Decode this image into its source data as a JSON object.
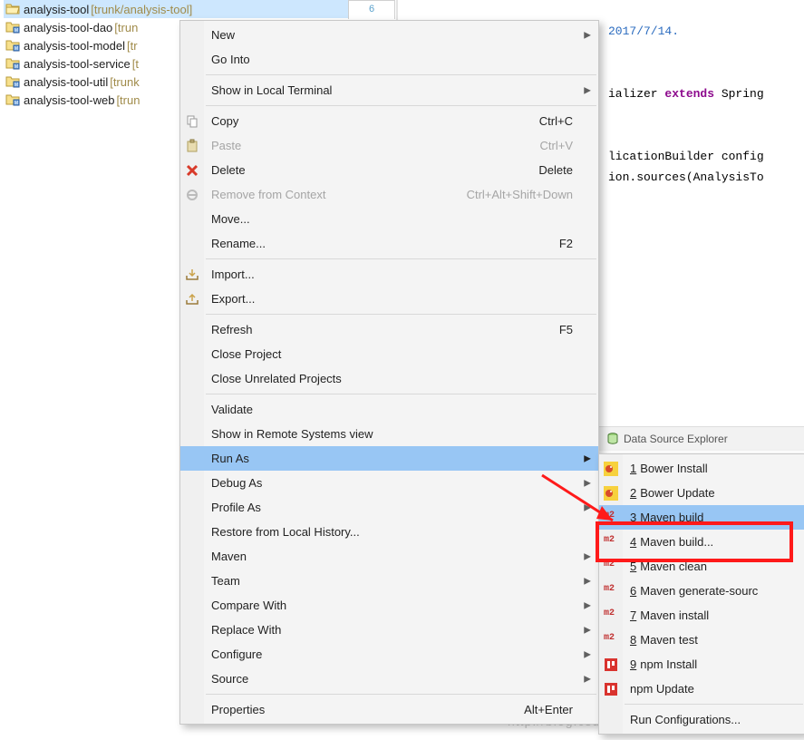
{
  "projects": [
    {
      "name": "analysis-tool",
      "repo": "[trunk/analysis-tool]",
      "selected": true,
      "open": true
    },
    {
      "name": "analysis-tool-dao",
      "repo": "[trun",
      "selected": false,
      "open": false
    },
    {
      "name": "analysis-tool-model",
      "repo": "[tr",
      "selected": false,
      "open": false
    },
    {
      "name": "analysis-tool-service",
      "repo": "[t",
      "selected": false,
      "open": false
    },
    {
      "name": "analysis-tool-util",
      "repo": "[trunk",
      "selected": false,
      "open": false
    },
    {
      "name": "analysis-tool-web",
      "repo": "[trun",
      "selected": false,
      "open": false
    }
  ],
  "editor": {
    "tab_number": "6",
    "line_date": "2017/7/14.",
    "line_code1_a": "ializer ",
    "line_code1_kw": "extends",
    "line_code1_b": " Spring",
    "line_code2": "licationBuilder config",
    "line_code3": "ion.sources(AnalysisTo"
  },
  "view_tab": {
    "label": "Data Source Explorer"
  },
  "ctx1": [
    {
      "type": "item",
      "label": "New",
      "arrow": true
    },
    {
      "type": "item",
      "label": "Go Into"
    },
    {
      "type": "sep"
    },
    {
      "type": "item",
      "label": "Show in Local Terminal",
      "arrow": true
    },
    {
      "type": "sep"
    },
    {
      "type": "item",
      "label": "Copy",
      "icon": "copy",
      "shortcut": "Ctrl+C"
    },
    {
      "type": "item",
      "label": "Paste",
      "icon": "paste",
      "shortcut": "Ctrl+V",
      "disabled": true
    },
    {
      "type": "item",
      "label": "Delete",
      "icon": "delete",
      "shortcut": "Delete"
    },
    {
      "type": "item",
      "label": "Remove from Context",
      "icon": "remove",
      "shortcut": "Ctrl+Alt+Shift+Down",
      "disabled": true
    },
    {
      "type": "item",
      "label": "Move..."
    },
    {
      "type": "item",
      "label": "Rename...",
      "shortcut": "F2"
    },
    {
      "type": "sep"
    },
    {
      "type": "item",
      "label": "Import...",
      "icon": "import"
    },
    {
      "type": "item",
      "label": "Export...",
      "icon": "export"
    },
    {
      "type": "sep"
    },
    {
      "type": "item",
      "label": "Refresh",
      "shortcut": "F5"
    },
    {
      "type": "item",
      "label": "Close Project"
    },
    {
      "type": "item",
      "label": "Close Unrelated Projects"
    },
    {
      "type": "sep"
    },
    {
      "type": "item",
      "label": "Validate"
    },
    {
      "type": "item",
      "label": "Show in Remote Systems view"
    },
    {
      "type": "item",
      "label": "Run As",
      "arrow": true,
      "hl": true
    },
    {
      "type": "item",
      "label": "Debug As",
      "arrow": true
    },
    {
      "type": "item",
      "label": "Profile As",
      "arrow": true
    },
    {
      "type": "item",
      "label": "Restore from Local History..."
    },
    {
      "type": "item",
      "label": "Maven",
      "arrow": true
    },
    {
      "type": "item",
      "label": "Team",
      "arrow": true
    },
    {
      "type": "item",
      "label": "Compare With",
      "arrow": true
    },
    {
      "type": "item",
      "label": "Replace With",
      "arrow": true
    },
    {
      "type": "item",
      "label": "Configure",
      "arrow": true
    },
    {
      "type": "item",
      "label": "Source",
      "arrow": true
    },
    {
      "type": "sep"
    },
    {
      "type": "item",
      "label": "Properties",
      "shortcut": "Alt+Enter"
    }
  ],
  "ctx2": [
    {
      "icon": "bower",
      "num": "1",
      "label": "Bower Install"
    },
    {
      "icon": "bower",
      "num": "2",
      "label": "Bower Update"
    },
    {
      "icon": "m2",
      "num": "3",
      "label": "Maven build",
      "hl": true
    },
    {
      "icon": "m2",
      "num": "4",
      "label": "Maven build..."
    },
    {
      "icon": "m2",
      "num": "5",
      "label": "Maven clean"
    },
    {
      "icon": "m2",
      "num": "6",
      "label": "Maven generate-sourc"
    },
    {
      "icon": "m2",
      "num": "7",
      "label": "Maven install"
    },
    {
      "icon": "m2",
      "num": "8",
      "label": "Maven test"
    },
    {
      "icon": "npm",
      "num": "9",
      "label": "npm Install"
    },
    {
      "icon": "npm",
      "num": "",
      "label": "npm Update"
    },
    {
      "type": "sep"
    },
    {
      "icon": "",
      "num": "",
      "label": "Run Configurations..."
    }
  ],
  "watermark": "http://blog.csdn.net/..."
}
